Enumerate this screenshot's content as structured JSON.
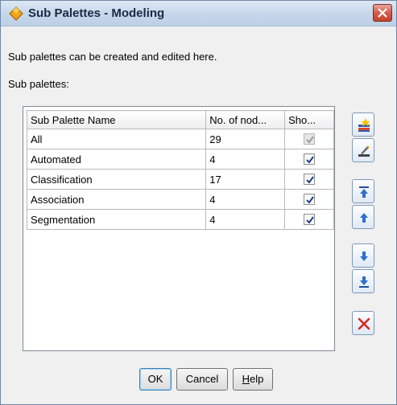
{
  "window": {
    "title": "Sub Palettes - Modeling"
  },
  "description": "Sub palettes can be created and edited here.",
  "sub_palettes_label": "Sub palettes:",
  "table": {
    "headers": [
      "Sub Palette Name",
      "No. of nod...",
      "Sho..."
    ],
    "rows": [
      {
        "name": "All",
        "count": "29",
        "show": true,
        "disabled": true
      },
      {
        "name": "Automated",
        "count": "4",
        "show": true,
        "disabled": false
      },
      {
        "name": "Classification",
        "count": "17",
        "show": true,
        "disabled": false
      },
      {
        "name": "Association",
        "count": "4",
        "show": true,
        "disabled": false
      },
      {
        "name": "Segmentation",
        "count": "4",
        "show": true,
        "disabled": false
      }
    ]
  },
  "side_buttons": [
    "add-sub-palette-icon",
    "edit-sub-palette-icon",
    "move-to-top-icon",
    "move-up-icon",
    "move-down-icon",
    "move-to-bottom-icon",
    "delete-icon"
  ],
  "buttons": {
    "ok": "OK",
    "cancel": "Cancel",
    "help_prefix": "",
    "help_accel": "H",
    "help_rest": "elp"
  },
  "colors": {
    "titlebar": "#c6d7ea",
    "accent": "#3a66b0",
    "delete": "#d8281e"
  }
}
